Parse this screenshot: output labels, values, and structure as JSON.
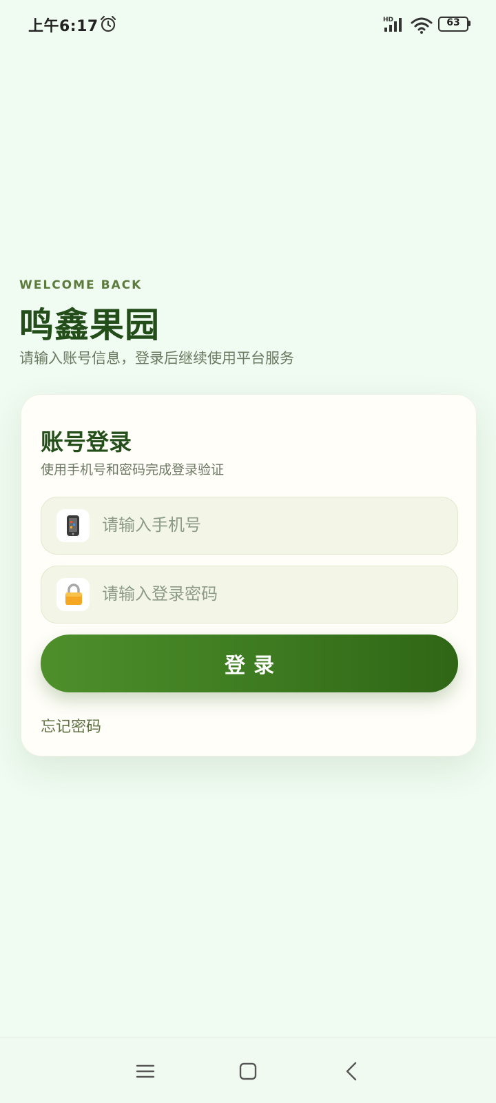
{
  "status_bar": {
    "time": "上午6:17",
    "battery_level": "63"
  },
  "header": {
    "eyebrow": "WELCOME BACK",
    "title": "鸣鑫果园",
    "subtitle": "请输入账号信息，登录后继续使用平台服务"
  },
  "login_card": {
    "title": "账号登录",
    "subtitle": "使用手机号和密码完成登录验证",
    "phone_field": {
      "placeholder": "请输入手机号",
      "value": "",
      "icon": "mobile-phone-icon"
    },
    "password_field": {
      "placeholder": "请输入登录密码",
      "value": "",
      "icon": "lock-icon"
    },
    "login_button_label": "登录",
    "forgot_password_label": "忘记密码"
  },
  "nav_bar": {
    "icons": [
      "menu-icon",
      "home-icon",
      "back-icon"
    ]
  },
  "colors": {
    "background": "#f0fbf1",
    "primary_green": "#3d7a20",
    "title_green": "#244e1a",
    "accent_olive": "#5b7a3c"
  }
}
